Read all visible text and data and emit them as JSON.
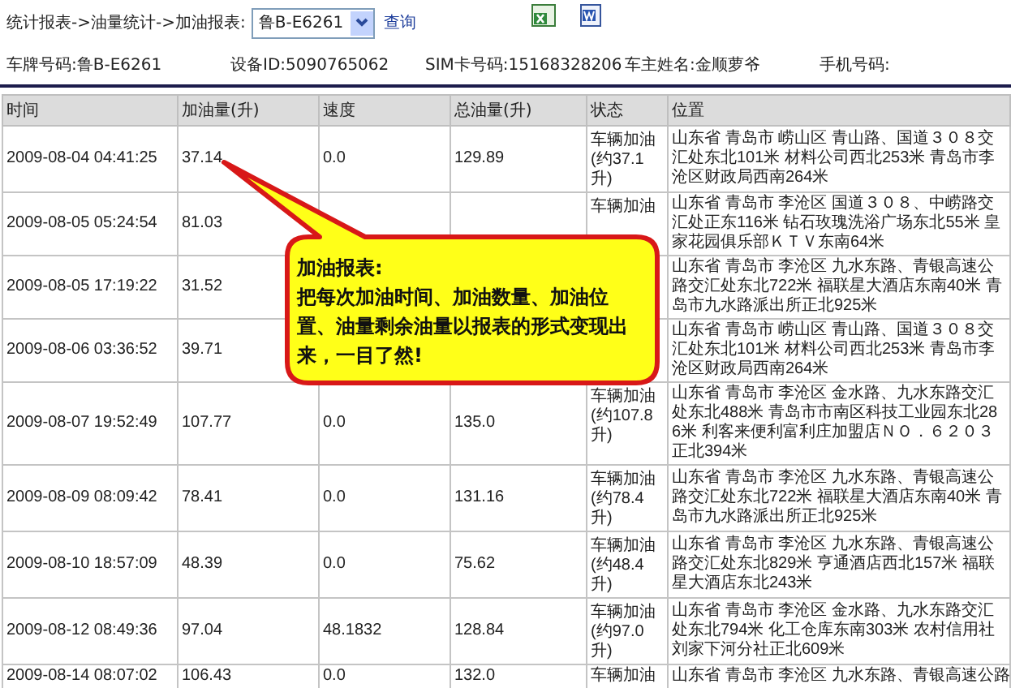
{
  "toolbar": {
    "breadcrumb": "统计报表->油量统计->加油报表:",
    "vehicle_select": {
      "value": "鲁B-E6261"
    },
    "query_link": "查询"
  },
  "vehicle_info": [
    "车牌号码:鲁B-E6261",
    "设备ID:5090765062",
    "SIM卡号码:15168328206",
    "车主姓名:金顺萝爷",
    "手机号码:"
  ],
  "table": {
    "columns": [
      "时间",
      "加油量(升)",
      "速度",
      "总油量(升)",
      "状态",
      "位置"
    ],
    "rows": [
      [
        "2009-08-04 04:41:25",
        "37.14",
        "0.0",
        "129.89",
        "车辆加油(约37.1升)",
        "山东省 青岛市 崂山区 青山路、国道３０８交汇处东北101米 材料公司西北253米 青岛市李沧区财政局西南264米"
      ],
      [
        "2009-08-05 05:24:54",
        "81.03",
        "",
        "",
        "车辆加油",
        "山东省 青岛市 李沧区 国道３０８、中崂路交汇处正东116米 钻石玫瑰洗浴广场东北55米 皇家花园俱乐部ＫＴＶ东南64米"
      ],
      [
        "2009-08-05 17:19:22",
        "31.52",
        "",
        "",
        "",
        "山东省 青岛市 李沧区 九水东路、青银高速公路交汇处东北722米 福联星大酒店东南40米 青岛市九水路派出所正北925米"
      ],
      [
        "2009-08-06 03:36:52",
        "39.71",
        "",
        "",
        "",
        "山东省 青岛市 崂山区 青山路、国道３０８交汇处东北101米 材料公司西北253米 青岛市李沧区财政局西南264米"
      ],
      [
        "2009-08-07 19:52:49",
        "107.77",
        "0.0",
        "135.0",
        "车辆加油(约107.8升)",
        "山东省 青岛市 李沧区 金水路、九水东路交汇处东北488米 青岛市市南区科技工业园东北286米 利客来便利富利庄加盟店ＮＯ．６２０３正北394米"
      ],
      [
        "2009-08-09 08:09:42",
        "78.41",
        "0.0",
        "131.16",
        "车辆加油(约78.4升)",
        "山东省 青岛市 李沧区 九水东路、青银高速公路交汇处东北722米 福联星大酒店东南40米 青岛市九水路派出所正北925米"
      ],
      [
        "2009-08-10 18:57:09",
        "48.39",
        "0.0",
        "75.62",
        "车辆加油(约48.4升)",
        "山东省 青岛市 李沧区 九水东路、青银高速公路交汇处东北829米 亨通酒店西北157米 福联星大酒店东北243米"
      ],
      [
        "2009-08-12 08:49:36",
        "97.04",
        "48.1832",
        "128.84",
        "车辆加油(约97.0升)",
        "山东省 青岛市 李沧区 金水路、九水东路交汇处东北794米 化工仓库东南303米 农村信用社刘家下河分社正北609米"
      ],
      [
        "2009-08-14 08:07:02",
        "106.43",
        "0.0",
        "132.0",
        "车辆加油",
        "山东省 青岛市 李沧区 九水东路、青银高速公路"
      ]
    ]
  },
  "callout": {
    "title": "加油报表:",
    "body": "把每次加油时间、加油数量、加油位置、油量剩余油量以报表的形式变现出来，一目了然!"
  }
}
